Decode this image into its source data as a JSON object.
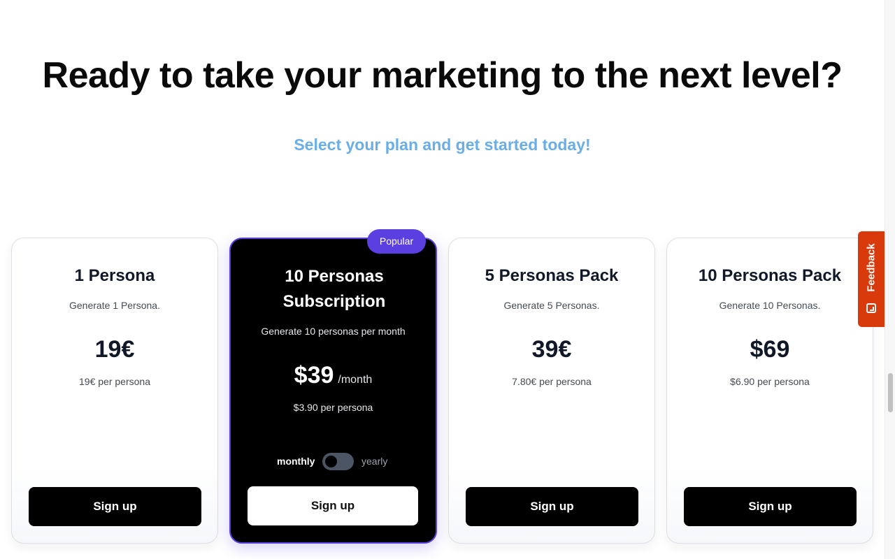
{
  "hero": {
    "heading": "Ready to take your marketing to the next level?",
    "subheading": "Select your plan and get started today!"
  },
  "plans": [
    {
      "title": "1 Persona",
      "description": "Generate 1 Persona.",
      "price": "19€",
      "per_persona": "19€ per persona",
      "cta": "Sign up"
    },
    {
      "title": "10 Personas Subscription",
      "description": "Generate 10 personas per month",
      "price": "$39",
      "price_unit": "/month",
      "per_persona": "$3.90 per persona",
      "badge": "Popular",
      "toggle_left": "monthly",
      "toggle_right": "yearly",
      "cta": "Sign up"
    },
    {
      "title": "5 Personas Pack",
      "description": "Generate 5 Personas.",
      "price": "39€",
      "per_persona": "7.80€ per persona",
      "cta": "Sign up"
    },
    {
      "title": "10 Personas Pack",
      "description": "Generate 10 Personas.",
      "price": "$69",
      "per_persona": "$6.90 per persona",
      "cta": "Sign up"
    }
  ],
  "feedback": {
    "label": "Feedback"
  },
  "colors": {
    "accent": "#5b3fe0",
    "subheading": "#6aaee6",
    "feedback": "#d93a0c"
  }
}
